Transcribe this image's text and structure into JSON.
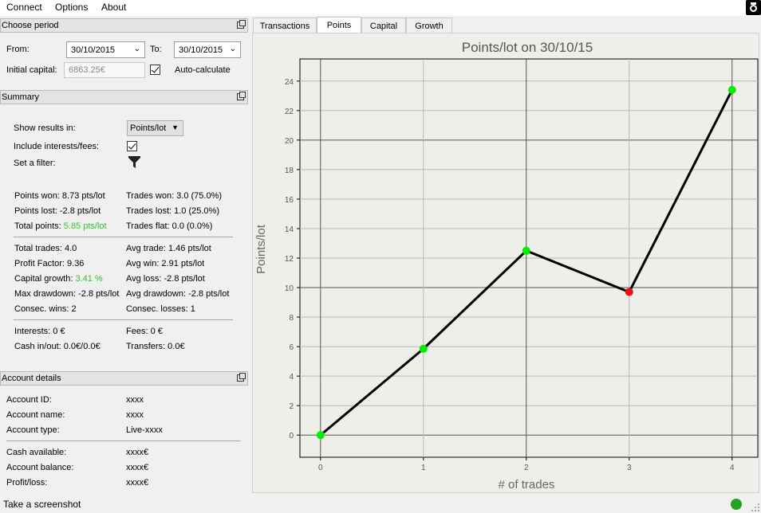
{
  "menu": {
    "items": [
      "Connect",
      "Options",
      "About"
    ]
  },
  "period": {
    "header": "Choose period",
    "from_label": "From:",
    "from_value": "30/10/2015",
    "to_label": "To:",
    "to_value": "30/10/2015",
    "capital_label": "Initial capital:",
    "capital_value": "6863.25€",
    "auto_label": "Auto-calculate",
    "auto_checked": true
  },
  "summary": {
    "header": "Summary",
    "show_label": "Show results in:",
    "show_value": "Points/lot",
    "interests_label": "Include interests/fees:",
    "interests_checked": true,
    "filter_label": "Set a filter:",
    "points_won": "Points won: 8.73 pts/lot",
    "points_lost": "Points lost: -2.8 pts/lot",
    "total_points_label": "Total points:",
    "total_points_value": "5.85 pts/lot",
    "trades_won": "Trades won: 3.0 (75.0%)",
    "trades_lost": "Trades lost: 1.0 (25.0%)",
    "trades_flat": "Trades flat: 0.0 (0.0%)",
    "total_trades": "Total trades: 4.0",
    "profit_factor": "Profit Factor: 9.36",
    "capital_growth_label": "Capital growth:",
    "capital_growth_value": "3.41 %",
    "max_drawdown": "Max drawdown: -2.8 pts/lot",
    "consec_wins": "Consec. wins: 2",
    "avg_trade": "Avg trade: 1.46 pts/lot",
    "avg_win": "Avg win: 2.91 pts/lot",
    "avg_loss": "Avg loss: -2.8 pts/lot",
    "avg_drawdown": "Avg drawdown: -2.8 pts/lot",
    "consec_losses": "Consec. losses: 1",
    "interests": "Interests: 0 €",
    "cash_inout": "Cash in/out: 0.0€/0.0€",
    "fees": "Fees: 0 €",
    "transfers": "Transfers: 0.0€"
  },
  "account": {
    "header": "Account details",
    "id_label": "Account ID:",
    "id_value": "xxxx",
    "name_label": "Account name:",
    "name_value": "xxxx",
    "type_label": "Account type:",
    "type_value": "Live-xxxx",
    "cash_label": "Cash available:",
    "cash_value": "xxxx€",
    "balance_label": "Account balance:",
    "balance_value": "xxxx€",
    "pl_label": "Profit/loss:",
    "pl_value": "xxxx€"
  },
  "tabs": [
    "Transactions",
    "Points",
    "Capital",
    "Growth"
  ],
  "active_tab": "Points",
  "status": {
    "text": "Take a screenshot",
    "indicator_color": "#22a322"
  },
  "colors": {
    "win": "#00ee00",
    "loss": "#ee1111",
    "positive_text": "#2fc42f",
    "line": "#000000"
  },
  "chart_data": {
    "type": "line",
    "title": "Points/lot on 30/10/15",
    "xlabel": "# of trades",
    "ylabel": "Points/lot",
    "x": [
      0,
      1,
      2,
      3,
      4
    ],
    "y": [
      0,
      5.85,
      12.5,
      9.7,
      23.4
    ],
    "point_status": [
      "win",
      "win",
      "win",
      "loss",
      "win"
    ],
    "xlim": [
      -0.2,
      4.25
    ],
    "ylim": [
      -1.5,
      25.5
    ],
    "xticks": [
      0,
      1,
      2,
      3,
      4
    ],
    "yticks": [
      0,
      2,
      4,
      6,
      8,
      10,
      12,
      14,
      16,
      18,
      20,
      22,
      24
    ],
    "grid": true
  }
}
